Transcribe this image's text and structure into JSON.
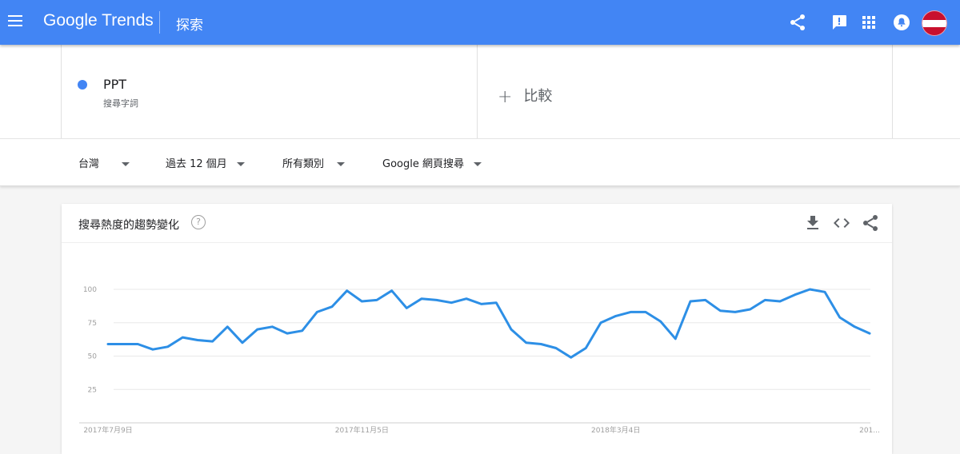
{
  "app": {
    "logo_text": "Google Trends",
    "section_title": "探索"
  },
  "header_icons": [
    "share-icon",
    "feedback-icon",
    "apps-icon",
    "notifications-icon"
  ],
  "colors": {
    "topbar": "#4285f4",
    "series": "#4285f4",
    "line": "#2d8fe6"
  },
  "search_term": {
    "name": "PPT",
    "type": "搜尋字詞"
  },
  "compare": {
    "plus": "+",
    "label": "比較"
  },
  "filters": {
    "region": "台灣",
    "period": "過去 12 個月",
    "category": "所有類別",
    "search_type": "Google 網頁搜尋"
  },
  "card": {
    "title": "搜尋熱度的趨勢變化",
    "help_symbol": "?",
    "icons": [
      "download-icon",
      "embed-icon",
      "share-icon"
    ]
  },
  "chart_data": {
    "type": "line",
    "series": [
      {
        "values": [
          59,
          59,
          59,
          55,
          57,
          64,
          62,
          61,
          72,
          60,
          70,
          72,
          67,
          69,
          83,
          87,
          99,
          91,
          92,
          99,
          86,
          93,
          92,
          90,
          93,
          89,
          90,
          70,
          60,
          59,
          56,
          49,
          56,
          75,
          80,
          83,
          83,
          76,
          63,
          91,
          92,
          84,
          83,
          85,
          92,
          91,
          96,
          100,
          98,
          79,
          72,
          67
        ]
      }
    ],
    "y_ticks": [
      "25",
      "50",
      "75",
      "100"
    ],
    "ylim": [
      0,
      100
    ],
    "x_labels": [
      {
        "index": 0,
        "label": "2017年7月9日"
      },
      {
        "index": 17,
        "label": "2017年11月5日"
      },
      {
        "index": 34,
        "label": "2018年3月4日"
      },
      {
        "index": 51,
        "label": "201..."
      }
    ],
    "grid": true
  }
}
